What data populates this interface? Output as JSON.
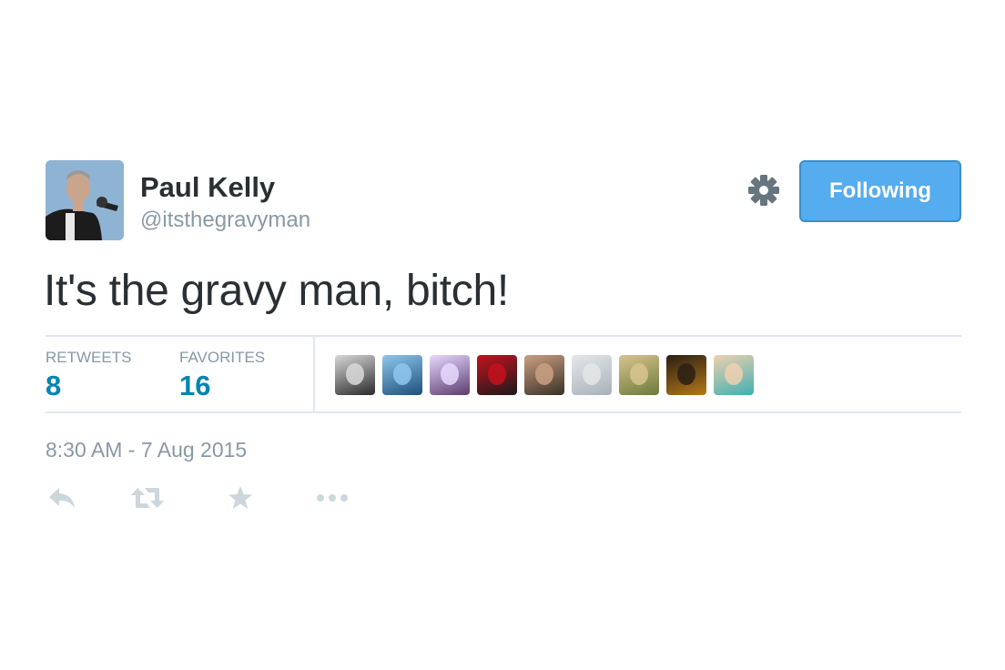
{
  "author": {
    "name": "Paul Kelly",
    "handle": "@itsthegravyman",
    "avatar_icon": "profile-photo"
  },
  "follow_button": {
    "label": "Following",
    "color": "#55acee"
  },
  "settings": {
    "icon": "gear-icon"
  },
  "tweet": {
    "text": "It's the gravy man, bitch!"
  },
  "stats": {
    "retweets": {
      "label": "RETWEETS",
      "count": "8"
    },
    "favorites": {
      "label": "FAVORITES",
      "count": "16"
    },
    "favoriter_avatars": [
      {
        "icon": "user-avatar",
        "colors": [
          "#2a2a2a",
          "#d9d9d9"
        ]
      },
      {
        "icon": "user-avatar",
        "colors": [
          "#1d4f7a",
          "#8ec8ee"
        ]
      },
      {
        "icon": "user-avatar",
        "colors": [
          "#5a3c6e",
          "#e8d9ff"
        ]
      },
      {
        "icon": "user-avatar",
        "colors": [
          "#1a1a1a",
          "#c4121f"
        ]
      },
      {
        "icon": "user-avatar",
        "colors": [
          "#3a3026",
          "#caa082"
        ]
      },
      {
        "icon": "user-avatar",
        "colors": [
          "#a9b2b8",
          "#e4e7ea"
        ]
      },
      {
        "icon": "user-avatar",
        "colors": [
          "#6b7a3a",
          "#d9c48f"
        ]
      },
      {
        "icon": "user-avatar",
        "colors": [
          "#b67818",
          "#2a1e14"
        ]
      },
      {
        "icon": "user-avatar",
        "colors": [
          "#3fb0b0",
          "#f0d0b0"
        ]
      }
    ]
  },
  "timestamp": "8:30 AM - 7 Aug 2015",
  "actions": [
    "reply-icon",
    "retweet-icon",
    "favorite-icon",
    "more-icon"
  ],
  "colors": {
    "link_blue": "#0084b4",
    "muted": "#8899a6",
    "divider": "#e1e8ed",
    "action_gray": "#ccd6dd"
  }
}
